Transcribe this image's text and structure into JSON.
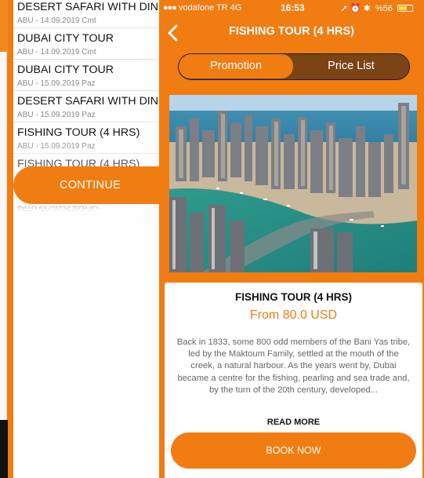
{
  "left_screen": {
    "tours": [
      {
        "name": "DESERT SAFARI WITH DINNE",
        "meta": "ABU - 14.09.2019 Cmt"
      },
      {
        "name": "DUBAI CITY TOUR",
        "meta": "ABU - 14.09.2019 Cmt"
      },
      {
        "name": "DUBAI CITY TOUR",
        "meta": "ABU - 15.09.2019 Paz"
      },
      {
        "name": "DESERT SAFARI WITH DINN",
        "meta": "ABU - 15.09.2019 Paz"
      },
      {
        "name": "FISHING TOUR (4 HRS)",
        "meta": "ABU - 15.09.2019 Paz"
      },
      {
        "name": "FISHING TOUR (4 HRS)",
        "meta": ""
      },
      {
        "name": "",
        "meta": "ABU - 16.09.2019 Pzt"
      },
      {
        "name": "DUBAI CITY TOUR",
        "meta": ""
      }
    ],
    "continue_label": "CONTINUE"
  },
  "status_bar": {
    "carrier": "vodafone TR  4G",
    "time": "16:53",
    "battery": "%56",
    "right_icons": "➚ ⏰ ✱"
  },
  "nav": {
    "title": "FISHING TOUR (4 HRS)"
  },
  "tabs": {
    "promotion": "Promotion",
    "price_list": "Price List",
    "selected": "Promotion"
  },
  "detail": {
    "title": "FISHING TOUR (4 HRS)",
    "price": "From 80.0 USD",
    "description": "Back in 1833, some 800 odd members of the Bani Yas tribe, led by the Maktoum Family, settled at the mouth of the creek, a natural harbour. As the years went by, Dubai became a centre for the fishing, pearling and sea trade and, by the turn of the 20th century, developed...",
    "read_more": "READ MORE",
    "book_label": "BOOK NOW"
  },
  "colors": {
    "accent": "#f07c12",
    "segment_inactive": "#7a4415",
    "text_muted": "#666666"
  },
  "icons": {
    "back": "chevron-left-icon",
    "battery": "battery-icon",
    "signal": "signal-dots-icon"
  }
}
